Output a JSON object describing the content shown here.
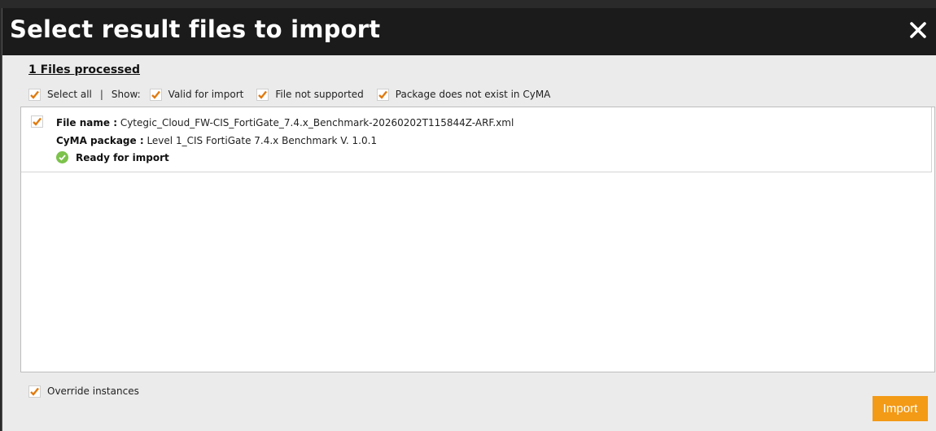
{
  "dialog": {
    "title": "Select result files to import",
    "close_icon": "close-icon"
  },
  "summary": {
    "files_processed": "1 Files processed"
  },
  "filters": {
    "select_all": {
      "label": "Select all",
      "checked": true
    },
    "separator": "|",
    "show_label": "Show:",
    "valid_for_import": {
      "label": "Valid for import",
      "checked": true
    },
    "file_not_supported": {
      "label": "File not supported",
      "checked": true
    },
    "package_not_exist": {
      "label": "Package does not exist in CyMA",
      "checked": true
    }
  },
  "files": [
    {
      "checked": true,
      "file_name_label": "File name :",
      "file_name": "Cytegic_Cloud_FW-CIS_FortiGate_7.4.x_Benchmark-20260202T115844Z-ARF.xml",
      "package_label": "CyMA package :",
      "package": "Level 1_CIS FortiGate 7.4.x Benchmark V. 1.0.1",
      "status": "Ready for import",
      "status_icon": "check-circle-icon"
    }
  ],
  "footer": {
    "override": {
      "label": "Override instances",
      "checked": true
    },
    "import_label": "Import"
  },
  "colors": {
    "accent": "#f39a16",
    "checkmark": "#e07b10",
    "status_ok": "#7cc24b",
    "titlebar": "#1b1b1b"
  }
}
